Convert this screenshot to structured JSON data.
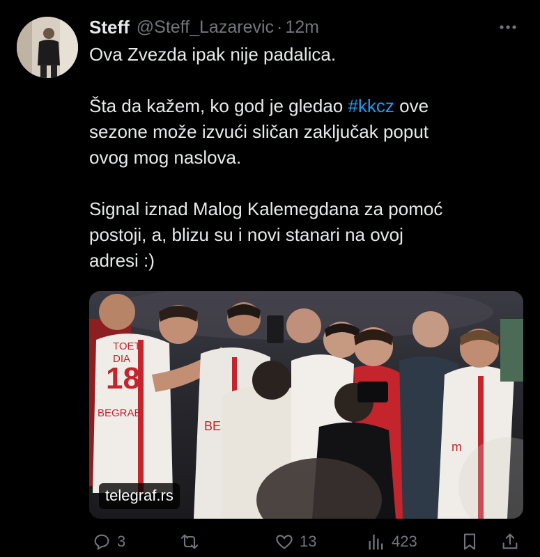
{
  "tweet": {
    "author_name": "Steff",
    "author_handle": "@Steff_Lazarevic",
    "separator": "·",
    "time": "12m",
    "paragraphs": [
      [
        "Ova Zvezda ipak nije padalica."
      ],
      [
        "Šta da kažem, ko god je gledao ",
        "#kkcz",
        " ove",
        "sezone može izvući sličan zaključak poput",
        "ovog mog naslova."
      ],
      [
        "Signal iznad Malog Kalemegdana za pomoć",
        "postoji, a, blizu su i novi stanari na ovoj",
        "adresi :)"
      ]
    ],
    "line1": "Ova Zvezda ipak nije padalica.",
    "p2_line1_a": "Šta da kažem, ko god je gledao ",
    "hashtag": "#kkcz",
    "p2_line1_b": " ove",
    "p2_line2": "sezone može izvući sličan zaključak poput",
    "p2_line3": "ovog mog naslova.",
    "p3_line1": "Signal iznad Malog Kalemegdana za pomoć",
    "p3_line2": "postoji, a, blizu su i novi stanari na ovoj",
    "p3_line3": "adresi :)",
    "hashtag_color": "#1d9bf0",
    "media": {
      "source_badge": "telegraf.rs",
      "jersey_number": "18",
      "jersey_text_top": "TOET",
      "jersey_text_mid": "DIA",
      "jersey_text_city": "BEGRAE",
      "jersey_text_2": "BE",
      "jersey_text_3": "m"
    },
    "actions": {
      "replies": "3",
      "retweets": "",
      "likes": "13",
      "views": "423"
    }
  },
  "icons": [
    "more-icon",
    "reply-icon",
    "retweet-icon",
    "like-icon",
    "views-icon",
    "bookmark-icon",
    "share-icon"
  ]
}
